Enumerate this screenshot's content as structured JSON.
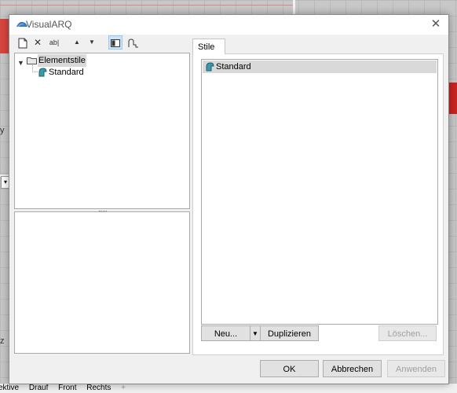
{
  "background": {
    "viewport_tabs": [
      "ektive",
      "Drauf",
      "Front",
      "Rechts"
    ],
    "side_letters": [
      "y",
      "z"
    ]
  },
  "dialog": {
    "title": "VisualARQ",
    "close_glyph": "✕"
  },
  "toolbar": {
    "icons": [
      {
        "name": "new-document-icon",
        "glyph": "🗋"
      },
      {
        "name": "delete-icon",
        "glyph": "✕"
      },
      {
        "name": "rename-icon",
        "glyph": "ab|"
      },
      {
        "name": "move-up-icon",
        "glyph": "▲"
      },
      {
        "name": "move-down-icon",
        "glyph": "▼"
      },
      {
        "name": "layout-view-icon",
        "glyph": "◧"
      },
      {
        "name": "profile-icon",
        "glyph": "⎍"
      }
    ]
  },
  "tree": {
    "root_label": "Elementstile",
    "child_label": "Standard"
  },
  "tabs": {
    "active": "Stile"
  },
  "styles_list": {
    "items": [
      "Standard"
    ]
  },
  "list_buttons": {
    "new": "Neu...",
    "duplicate": "Duplizieren",
    "delete": "Löschen..."
  },
  "footer_buttons": {
    "ok": "OK",
    "cancel": "Abbrechen",
    "apply": "Anwenden"
  },
  "colors": {
    "accent": "#0078d7",
    "selection": "#d9d9d9",
    "toolbar_active": "#cce4f7"
  }
}
